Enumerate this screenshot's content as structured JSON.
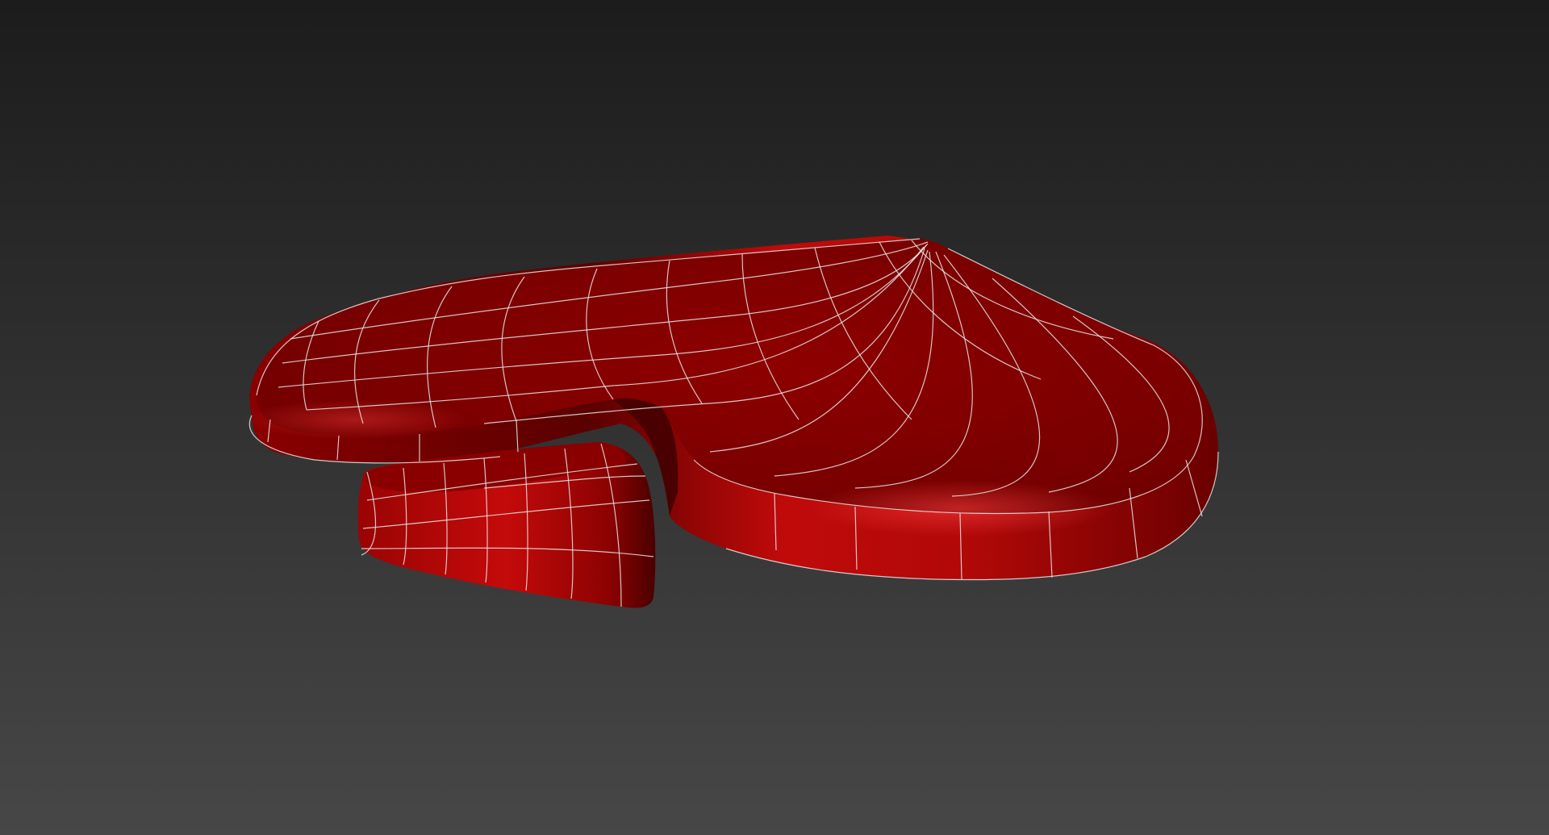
{
  "viewport": {
    "object": "spade-mesh",
    "shading": "smooth-with-wireframe-edges",
    "background": {
      "top": "#1c1c1c",
      "bottom": "#474747"
    },
    "colors": {
      "mesh_dark": "#3a0000",
      "mesh_mid": "#7d0000",
      "mesh_light": "#c80a0a",
      "mesh_highlight": "#e83030",
      "wire": "#e6e6e6"
    }
  }
}
